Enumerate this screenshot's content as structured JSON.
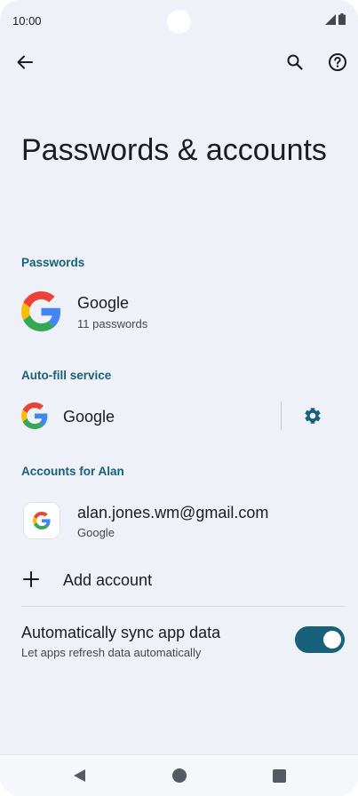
{
  "status": {
    "time": "10:00"
  },
  "page": {
    "title": "Passwords & accounts"
  },
  "passwords": {
    "header": "Passwords",
    "provider": "Google",
    "count": "11 passwords"
  },
  "autofill": {
    "header": "Auto-fill service",
    "service": "Google"
  },
  "accounts": {
    "header": "Accounts for Alan",
    "items": [
      {
        "email": "alan.jones.wm@gmail.com",
        "type": "Google"
      }
    ],
    "add_label": "Add account"
  },
  "sync": {
    "title": "Automatically sync app data",
    "subtitle": "Let apps refresh data automatically",
    "enabled": true
  },
  "colors": {
    "accent": "#17617a",
    "background": "#eef1f8"
  },
  "icons": [
    "back-arrow-icon",
    "search-icon",
    "help-icon",
    "google-logo-icon",
    "gear-icon",
    "plus-icon",
    "nav-back-icon",
    "nav-home-icon",
    "nav-recents-icon"
  ]
}
